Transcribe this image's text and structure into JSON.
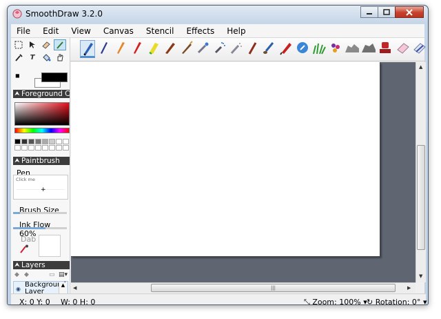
{
  "window": {
    "title": "SmoothDraw 3.2.0"
  },
  "menu": [
    "File",
    "Edit",
    "View",
    "Canvas",
    "Stencil",
    "Effects",
    "Help"
  ],
  "panels": {
    "foreground": {
      "title": "Foreground C"
    },
    "paintbrush": {
      "title": "Paintbrush",
      "brush_name": "Pen",
      "preview_hint": "Click me",
      "brush_size_label": "Brush Size",
      "ink_flow_label": "Ink Flow 60%",
      "ink_flow_value": 0.6,
      "dab_label": "Dab"
    },
    "layers": {
      "title": "Layers",
      "layer_name": "Background Layer"
    }
  },
  "statusbar": {
    "position": "X: 0 Y: 0",
    "size": "W: 0 H: 0",
    "zoom": "Zoom: 100%",
    "rotation": "Rotation: 0°"
  },
  "colors": {
    "foreground": "#000000",
    "background": "#ffffff",
    "canvas_bg": "#5f6672"
  },
  "brushes": [
    "pen",
    "ballpoint",
    "pencil",
    "crayon",
    "highlighter",
    "marker",
    "fountain-pen",
    "airbrush",
    "spray",
    "graffiti",
    "calligraphy",
    "brush",
    "pencil-red",
    "blur",
    "grass",
    "flower",
    "stamp-rock",
    "stamp-stone",
    "stamp-seal",
    "eraser",
    "eraser-hard"
  ]
}
